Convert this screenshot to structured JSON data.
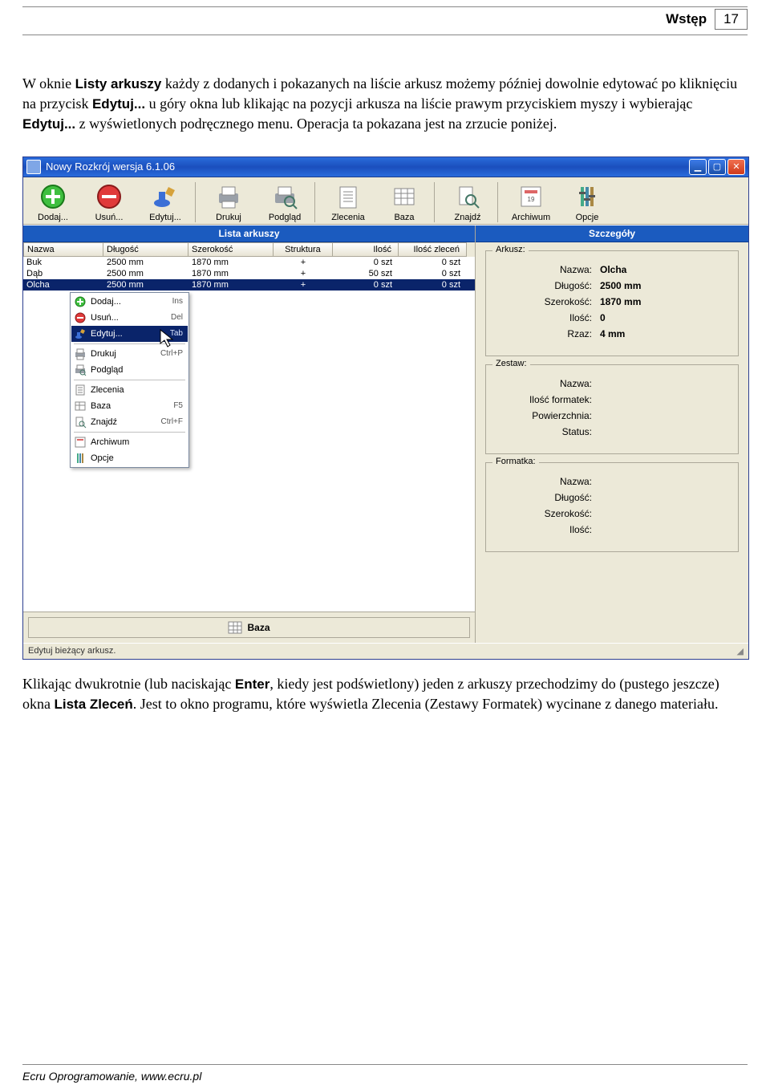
{
  "header": {
    "section": "Wstęp",
    "page_number": "17"
  },
  "para1_a": "W oknie ",
  "para1_b": "Listy arkuszy",
  "para1_c": " każdy z dodanych i pokazanych na liście arkusz możemy później dowolnie edytować po kliknięciu na przycisk ",
  "para1_d": "Edytuj...",
  "para1_e": " u góry okna lub klikając  na pozycji arkusza na liście prawym przyciskiem myszy i wybierając ",
  "para1_f": "Edytuj...",
  "para1_g": " z wyświetlonych podręcznego menu. Operacja ta pokazana jest na zrzucie poniżej.",
  "para2_a": "Klikając dwukrotnie (lub naciskając ",
  "para2_b": "Enter",
  "para2_c": ", kiedy jest podświetlony) jeden z arkuszy przechodzimy do (pustego jeszcze) okna ",
  "para2_d": "Lista Zleceń",
  "para2_e": ". Jest to okno programu, które wyświetla Zlecenia (Zestawy Formatek)  wycinane z danego materiału.",
  "app": {
    "title": "Nowy Rozkrój wersja 6.1.06",
    "toolbar": [
      {
        "id": "add",
        "label": "Dodaj..."
      },
      {
        "id": "remove",
        "label": "Usuń..."
      },
      {
        "id": "edit",
        "label": "Edytuj..."
      },
      {
        "id": "print",
        "label": "Drukuj"
      },
      {
        "id": "preview",
        "label": "Podgląd"
      },
      {
        "id": "orders",
        "label": "Zlecenia"
      },
      {
        "id": "base",
        "label": "Baza"
      },
      {
        "id": "find",
        "label": "Znajdź"
      },
      {
        "id": "archive",
        "label": "Archiwum"
      },
      {
        "id": "options",
        "label": "Opcje"
      }
    ],
    "left_title": "Lista arkuszy",
    "right_title": "Szczegóły",
    "columns": [
      "Nazwa",
      "Długość",
      "Szerokość",
      "Struktura",
      "Ilość",
      "Ilość zleceń"
    ],
    "rows": [
      {
        "n": "Buk",
        "d": "2500 mm",
        "s": "1870 mm",
        "st": "+",
        "il": "0 szt",
        "iz": "0 szt",
        "sel": false
      },
      {
        "n": "Dąb",
        "d": "2500 mm",
        "s": "1870 mm",
        "st": "+",
        "il": "50 szt",
        "iz": "0 szt",
        "sel": false
      },
      {
        "n": "Olcha",
        "d": "2500 mm",
        "s": "1870 mm",
        "st": "+",
        "il": "0 szt",
        "iz": "0 szt",
        "sel": true
      }
    ],
    "context_menu": [
      {
        "icon": "add",
        "label": "Dodaj...",
        "shortcut": "Ins"
      },
      {
        "icon": "remove",
        "label": "Usuń...",
        "shortcut": "Del"
      },
      {
        "icon": "edit",
        "label": "Edytuj...",
        "shortcut": "Tab",
        "selected": true
      },
      {
        "sep": true
      },
      {
        "icon": "print",
        "label": "Drukuj",
        "shortcut": "Ctrl+P"
      },
      {
        "icon": "preview",
        "label": "Podgląd",
        "shortcut": ""
      },
      {
        "sep": true
      },
      {
        "icon": "orders",
        "label": "Zlecenia",
        "shortcut": ""
      },
      {
        "icon": "base",
        "label": "Baza",
        "shortcut": "F5"
      },
      {
        "icon": "find",
        "label": "Znajdź",
        "shortcut": "Ctrl+F"
      },
      {
        "sep": true
      },
      {
        "icon": "archive",
        "label": "Archiwum",
        "shortcut": ""
      },
      {
        "icon": "options",
        "label": "Opcje",
        "shortcut": ""
      }
    ],
    "details": {
      "arkusz": {
        "title": "Arkusz:",
        "rows": [
          [
            "Nazwa:",
            "Olcha"
          ],
          [
            "Długość:",
            "2500 mm"
          ],
          [
            "Szerokość:",
            "1870 mm"
          ],
          [
            "Ilość:",
            "0"
          ],
          [
            "Rzaz:",
            "4 mm"
          ]
        ]
      },
      "zestaw": {
        "title": "Zestaw:",
        "rows": [
          [
            "Nazwa:",
            ""
          ],
          [
            "Ilość formatek:",
            ""
          ],
          [
            "Powierzchnia:",
            ""
          ],
          [
            "Status:",
            ""
          ]
        ]
      },
      "formatka": {
        "title": "Formatka:",
        "rows": [
          [
            "Nazwa:",
            ""
          ],
          [
            "Długość:",
            ""
          ],
          [
            "Szerokość:",
            ""
          ],
          [
            "Ilość:",
            ""
          ]
        ]
      }
    },
    "status_center": "Baza",
    "status_text": "Edytuj bieżący arkusz."
  },
  "footer": "Ecru Oprogramowanie, www.ecru.pl"
}
